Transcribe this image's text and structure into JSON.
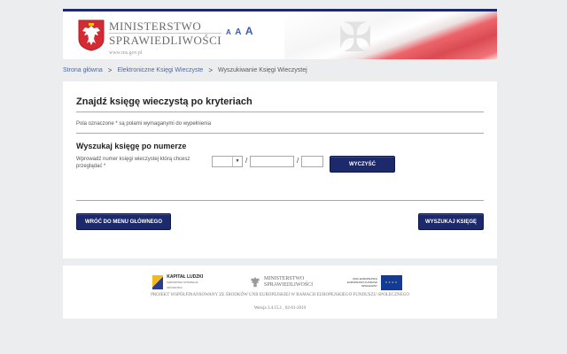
{
  "header": {
    "ministry_line1": "MINISTERSTWO",
    "ministry_line2": "SPRAWIEDLIWOŚCI",
    "url": "www.ms.gov.pl",
    "font_size_controls": [
      "A",
      "A",
      "A"
    ],
    "emblem_icon": "polish-eagle-emblem"
  },
  "breadcrumb": {
    "items": [
      "Strona główna",
      "Elektroniczne Księgi Wieczyste",
      "Wyszukiwanie Księgi Wieczystej"
    ],
    "separator": ">"
  },
  "main": {
    "title": "Znajdź księgę wieczystą po kryteriach",
    "required_note": "Pola oznaczone * są polami wymaganymi do wypełnienia",
    "section_title": "Wyszukaj księgę po numerze",
    "field_label": "Wprowadź numer księgi wieczystej którą chcesz przeglądać *",
    "court_code_select": {
      "value": ""
    },
    "number_input": {
      "value": ""
    },
    "check_digit_input": {
      "value": ""
    },
    "slash": "/",
    "clear_button": "WYCZYŚĆ",
    "back_button": "WRÓĆ DO MENU GŁÓWNEGO",
    "search_button": "WYSZUKAJ KSIĘGĘ"
  },
  "footer": {
    "logos": {
      "kapital_ludzki": "KAPITAŁ LUDZKI",
      "kapital_ludzki_sub": "NARODOWA STRATEGIA SPÓJNOŚCI",
      "ministry_line1": "MINISTERSTWO",
      "ministry_line2": "SPRAWIEDLIWOŚCI",
      "eu_text": "UNIA EUROPEJSKA EUROPEJSKI FUNDUSZ SPOŁECZNY"
    },
    "description": "PROJEKT WSPÓŁFINANSOWANY ZE ŚRODKÓW UNII EUROPEJSKIEJ W RAMACH EUROPEJSKIEGO FUNDUSZU SPOŁECZNEGO",
    "version": "Wersja 3.4.15.1 , 02-01-2019"
  },
  "colors": {
    "button_bg": "#1c2a6b",
    "link": "#51679c",
    "page_bg": "#ecedef",
    "accent_red": "#d42a33"
  }
}
